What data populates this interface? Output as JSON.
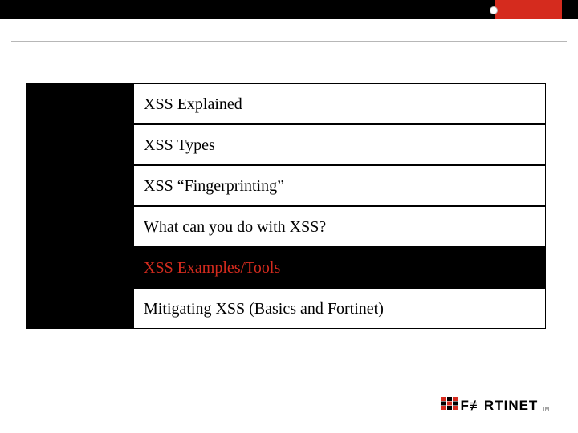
{
  "agenda": {
    "items": [
      {
        "label": "XSS Explained",
        "active": false
      },
      {
        "label": "XSS Types",
        "active": false
      },
      {
        "label": "XSS “Fingerprinting”",
        "active": false
      },
      {
        "label": "What can you do with XSS?",
        "active": false
      },
      {
        "label": "XSS Examples/Tools",
        "active": true
      },
      {
        "label": "Mitigating XSS (Basics and Fortinet)",
        "active": false
      }
    ]
  },
  "branding": {
    "logo_text": "F≢RTINET",
    "tm": "TM"
  },
  "colors": {
    "accent": "#d52b1e",
    "black": "#000000"
  }
}
